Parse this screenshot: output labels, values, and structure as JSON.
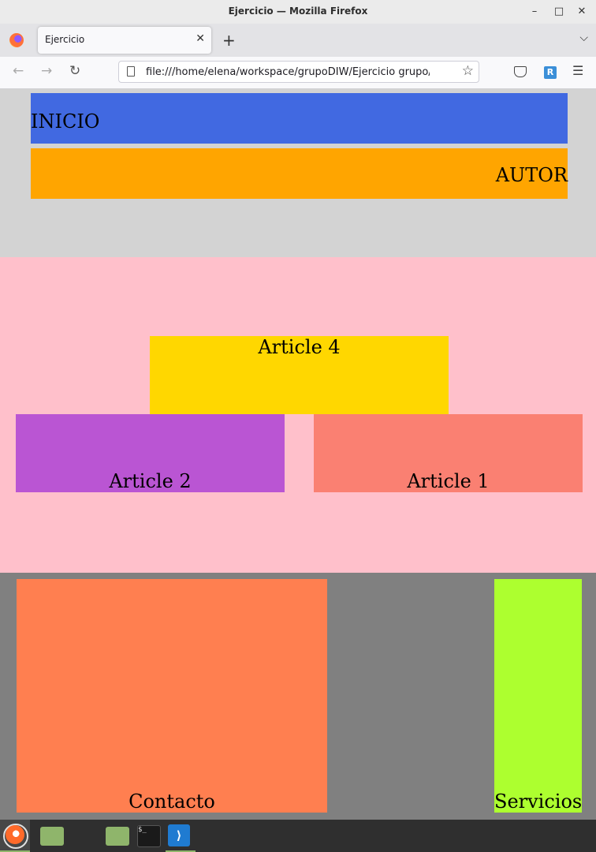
{
  "window": {
    "title": "Ejercicio — Mozilla Firefox",
    "controls": {
      "minimize": "–",
      "maximize": "□",
      "close": "✕"
    }
  },
  "tabs": [
    {
      "label": "Ejercicio",
      "close": "✕"
    }
  ],
  "tabstrip": {
    "new_tab": "+",
    "list_all": "⌵"
  },
  "navbar": {
    "back": "←",
    "forward": "→",
    "reload": "↻",
    "url": "file:///home/elena/workspace/grupoDIW/Ejercicio grupo/grupo",
    "bookmark": "☆",
    "extension_label": "R",
    "menu": "☰"
  },
  "page": {
    "header": {
      "inicio": "INICIO",
      "autor": "AUTOR"
    },
    "main": {
      "article4": "Article 4",
      "article2": "Article 2",
      "article1": "Article 1"
    },
    "footer": {
      "contacto": "Contacto",
      "servicios": "Servicios"
    }
  },
  "colors": {
    "inicio": "#4169e1",
    "autor": "#ffa500",
    "header_bg": "#d3d3d3",
    "main_bg": "#ffc0cb",
    "article4": "#ffd700",
    "article2": "#ba55d3",
    "article1": "#fa8072",
    "footer_bg": "#808080",
    "contacto": "#ff7f50",
    "servicios": "#adff2f"
  },
  "taskbar": {
    "icons": [
      "mint-menu-icon",
      "show-desktop-icon",
      "firefox-icon",
      "files-icon",
      "terminal-icon",
      "vscode-icon"
    ],
    "terminal_prompt": "$_"
  }
}
